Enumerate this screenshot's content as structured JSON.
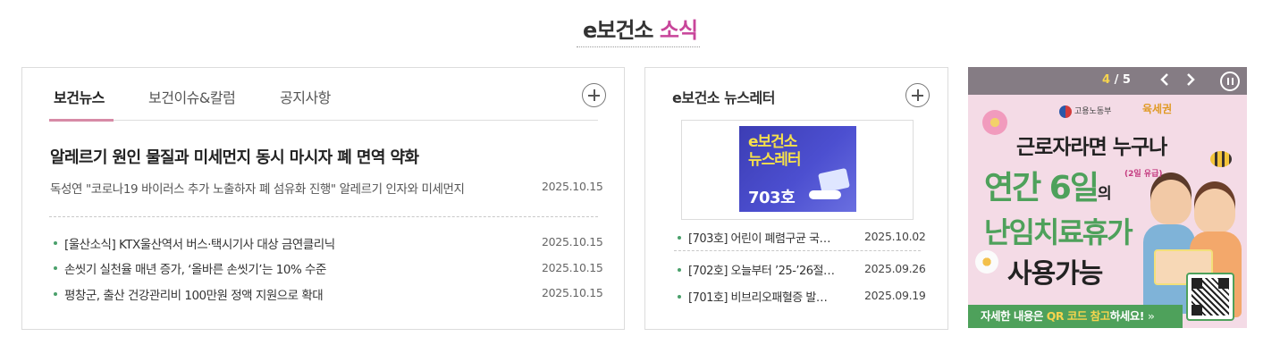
{
  "section": {
    "title_main": "e보건소",
    "title_accent": "소식"
  },
  "news": {
    "tabs": [
      "보건뉴스",
      "보건이슈&칼럼",
      "공지사항"
    ],
    "headline": "알레르기 원인 물질과 미세먼지 동시 마시자 폐 면역 약화",
    "summary": "독성연 \"코로나19 바이러스 추가 노출하자 폐 섬유화 진행\" 알레르기 인자와 미세먼지",
    "summary_date": "2025.10.15",
    "items": [
      {
        "title": "[울산소식] KTX울산역서 버스·택시기사 대상 금연클리닉",
        "date": "2025.10.15"
      },
      {
        "title": "손씻기 실천율 매년 증가, ‘올바른 손씻기’는 10% 수준",
        "date": "2025.10.15"
      },
      {
        "title": "평창군, 출산 건강관리비 100만원 정액 지원으로 확대",
        "date": "2025.10.15"
      }
    ]
  },
  "newsletter": {
    "title": "e보건소 뉴스레터",
    "thumb_line1": "e보건소",
    "thumb_line2": "뉴스레터",
    "thumb_issue": "703호",
    "items": [
      {
        "title": "[703호] 어린이 폐렴구균 국…",
        "date": "2025.10.02"
      },
      {
        "title": "[702호] 오늘부터 ’25-’26절…",
        "date": "2025.09.26"
      },
      {
        "title": "[701호] 비브리오패혈증 발…",
        "date": "2025.09.19"
      }
    ]
  },
  "banner": {
    "counter_current": "4",
    "counter_sep": "/",
    "counter_total": "5",
    "ministry": "고용노동부",
    "brand": "육세권",
    "line1": "근로자라면 누구나",
    "line2_a": "연간 6일",
    "line2_b": "의",
    "superscript": "(2일 유급)",
    "line3": "난임치료휴가",
    "line4": "사용가능",
    "cta_a": "자세한 내용은 ",
    "cta_hl": "QR 코드 참고",
    "cta_b": "하세요!",
    "cta_arrow": "»"
  },
  "colors": {
    "accent_pink": "#c8459a",
    "bullet_green": "#4aa06b",
    "banner_green": "#4ea15b",
    "banner_bg": "#f4dbe6"
  }
}
